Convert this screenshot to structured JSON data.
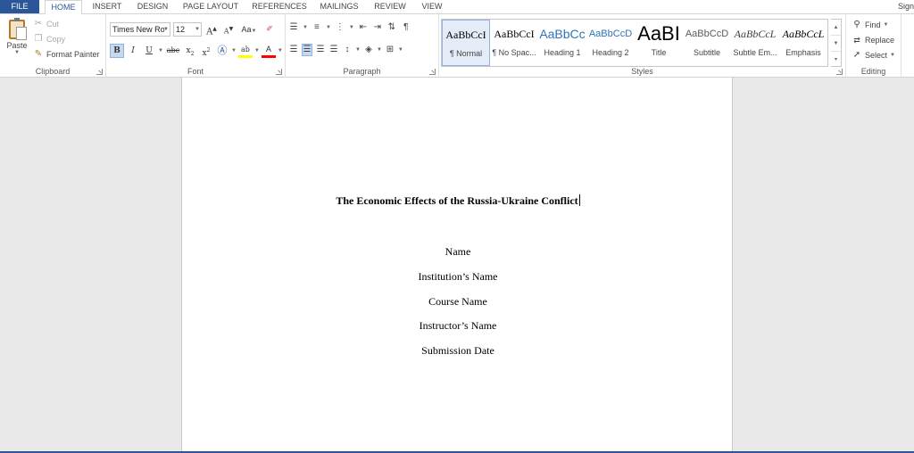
{
  "tabs": {
    "file": "FILE",
    "home": "HOME",
    "insert": "INSERT",
    "design": "DESIGN",
    "page_layout": "PAGE LAYOUT",
    "references": "REFERENCES",
    "mailings": "MAILINGS",
    "review": "REVIEW",
    "view": "VIEW",
    "signin": "Sign"
  },
  "clipboard": {
    "paste": "Paste",
    "cut": "Cut",
    "copy": "Copy",
    "format_painter": "Format Painter",
    "label": "Clipboard"
  },
  "font": {
    "family": "Times New Ro",
    "size": "12",
    "grow": "A",
    "shrink": "A",
    "change_case": "Aa",
    "bold": "B",
    "italic": "I",
    "underline": "U",
    "strike": "abc",
    "subscript": "x",
    "superscript": "x",
    "label": "Font"
  },
  "paragraph": {
    "label": "Paragraph"
  },
  "styles": {
    "label": "Styles",
    "items": [
      {
        "sample": "AaBbCcI",
        "name": "¶ Normal"
      },
      {
        "sample": "AaBbCcI",
        "name": "¶ No Spac..."
      },
      {
        "sample": "AaBbCc",
        "name": "Heading 1"
      },
      {
        "sample": "AaBbCcD",
        "name": "Heading 2"
      },
      {
        "sample": "AaBI",
        "name": "Title"
      },
      {
        "sample": "AaBbCcD",
        "name": "Subtitle"
      },
      {
        "sample": "AaBbCcL",
        "name": "Subtle Em..."
      },
      {
        "sample": "AaBbCcL",
        "name": "Emphasis"
      }
    ]
  },
  "editing": {
    "find": "Find",
    "replace": "Replace",
    "select": "Select",
    "label": "Editing"
  },
  "document": {
    "title": "The Economic Effects of the Russia-Ukraine Conflict",
    "lines": [
      "Name",
      "Institution’s Name",
      "Course Name",
      "Instructor’s Name",
      "Submission Date"
    ]
  },
  "colors": {
    "accent": "#2b579a",
    "highlight": "#ffff00",
    "font_color": "#ff0000"
  }
}
